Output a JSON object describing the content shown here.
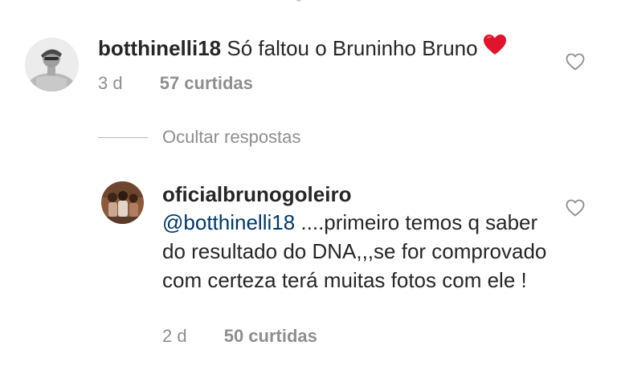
{
  "comment": {
    "username": "botthinelli18",
    "text": "Só faltou o Bruninho Bruno",
    "emoji_icon": "red-heart-emoji",
    "age": "3 d",
    "likes": "57 curtidas",
    "like_icon": "heart-outline-icon"
  },
  "hide_replies": {
    "label": "Ocultar respostas"
  },
  "reply": {
    "username": "oficialbrunogoleiro",
    "mention": "@botthinelli18",
    "text": " ....primeiro temos q saber do resultado do DNA,,,se for comprovado com certeza terá muitas fotos com ele !",
    "age": "2 d",
    "likes": "50 curtidas",
    "like_icon": "heart-outline-icon"
  },
  "colors": {
    "text": "#262626",
    "secondary": "#8e8e8e",
    "mention": "#00376b",
    "emoji_heart": "#e0142b"
  }
}
